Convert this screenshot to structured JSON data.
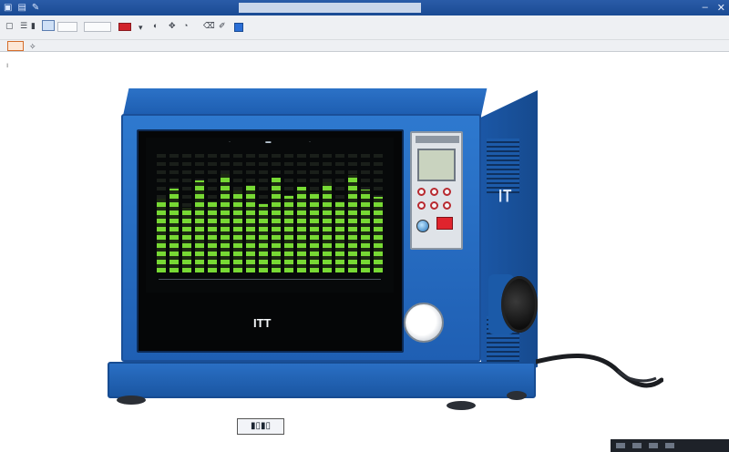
{
  "titlebar": {
    "icons": [
      "app-icon",
      "file-icon",
      "help-icon"
    ],
    "controls": [
      "minimize-icon",
      "close-icon"
    ]
  },
  "toolbar": {
    "colors": {
      "red_swatch": "#d1232b",
      "blue_swatch": "#2b6fd6"
    }
  },
  "device": {
    "screen_brand": "ITT",
    "side_brand": "IT",
    "colors": {
      "body": "#1f5fb3",
      "bar": "#77d934",
      "screen": "#07090a"
    },
    "bar_levels": [
      0.62,
      0.71,
      0.55,
      0.78,
      0.6,
      0.83,
      0.69,
      0.74,
      0.58,
      0.8,
      0.65,
      0.72,
      0.68,
      0.76,
      0.6,
      0.82,
      0.7,
      0.64
    ]
  }
}
